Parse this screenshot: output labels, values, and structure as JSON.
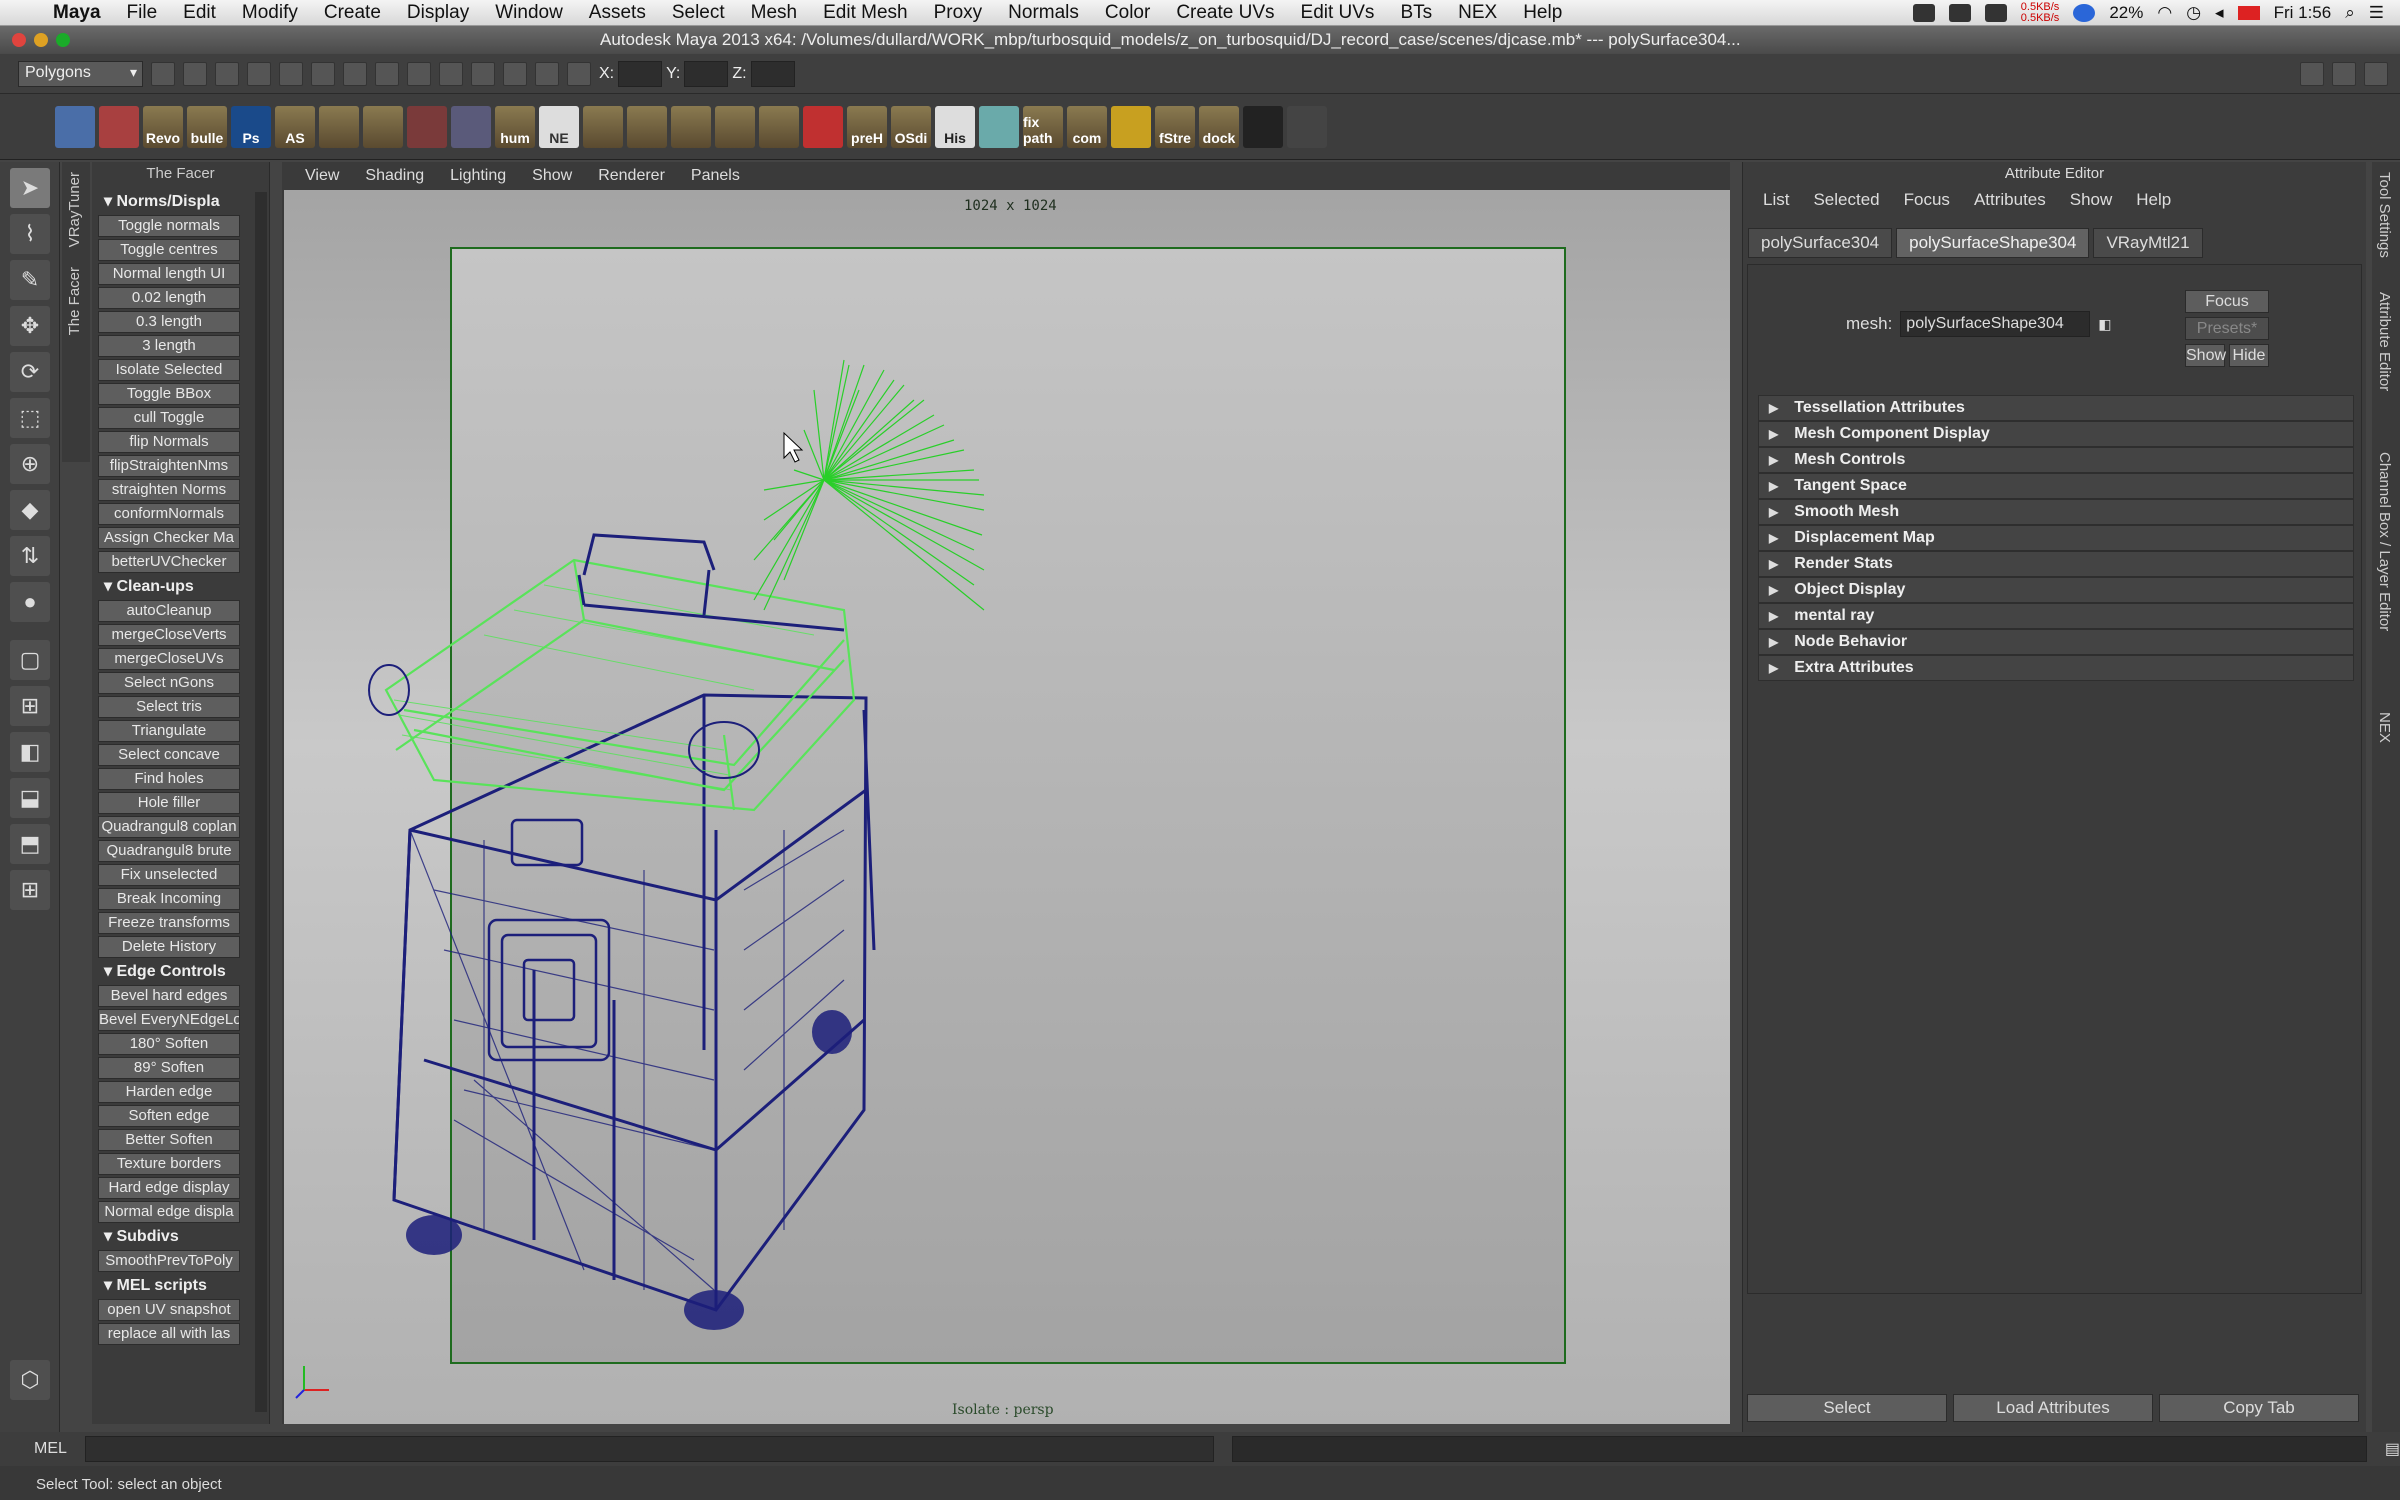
{
  "os_menubar": {
    "app_name": "Maya",
    "items": [
      "File",
      "Edit",
      "Modify",
      "Create",
      "Display",
      "Window",
      "Assets",
      "Select",
      "Mesh",
      "Edit Mesh",
      "Proxy",
      "Normals",
      "Color",
      "Create UVs",
      "Edit UVs",
      "BTs",
      "NEX",
      "Help"
    ],
    "battery": "22%",
    "clock": "Fri 1:56",
    "network_up": "0.5KB/s",
    "network_down": "0.5KB/s"
  },
  "window": {
    "title": "Autodesk Maya 2013 x64: /Volumes/dullard/WORK_mbp/turbosquid_models/z_on_turbosquid/DJ_record_case/scenes/djcase.mb*   ---   polySurface304..."
  },
  "status_line": {
    "mode": "Polygons",
    "x_label": "X:",
    "y_label": "Y:",
    "z_label": "Z:"
  },
  "shelf": {
    "icons": [
      "Revo",
      "bulle",
      "Ps",
      "AS",
      "hum",
      "NE",
      "preH",
      "OSdi",
      "His",
      "fix path",
      "com",
      "fStre",
      "dock"
    ]
  },
  "facer": {
    "title": "The Facer",
    "side_tabs": [
      "VRayTuner",
      "The Facer"
    ],
    "sections": [
      {
        "title": "Norms/Displa",
        "buttons": [
          "Toggle normals",
          "Toggle centres",
          "Normal length UI",
          "0.02 length",
          "0.3 length",
          "3 length",
          "Isolate Selected",
          "Toggle BBox",
          "cull Toggle",
          "flip Normals",
          "flipStraightenNms",
          "straighten Norms",
          "conformNormals",
          "Assign Checker Ma",
          "betterUVChecker"
        ]
      },
      {
        "title": "Clean-ups",
        "buttons": [
          "autoCleanup",
          "mergeCloseVerts",
          "mergeCloseUVs",
          "Select nGons",
          "Select tris",
          "Triangulate",
          "Select concave",
          "Find holes",
          "Hole filler",
          "Quadrangul8 coplan",
          "Quadrangul8 brute",
          "Fix unselected",
          "Break Incoming",
          "Freeze transforms",
          "Delete History"
        ]
      },
      {
        "title": "Edge Controls",
        "buttons": [
          "Bevel hard edges",
          "Bevel EveryNEdgeLoo",
          "180° Soften",
          "89° Soften",
          "Harden edge",
          "Soften edge",
          "Better Soften",
          "Texture borders",
          "Hard edge display",
          "Normal edge displa"
        ]
      },
      {
        "title": "Subdivs",
        "buttons": [
          "SmoothPrevToPoly"
        ]
      },
      {
        "title": "MEL scripts",
        "buttons": [
          "open UV snapshot",
          "replace all with las"
        ]
      }
    ]
  },
  "viewport": {
    "menu": [
      "View",
      "Shading",
      "Lighting",
      "Show",
      "Renderer",
      "Panels"
    ],
    "resolution_label": "1024 x 1024",
    "camera_label": "Isolate : persp"
  },
  "attribute_editor": {
    "title": "Attribute Editor",
    "menu": [
      "List",
      "Selected",
      "Focus",
      "Attributes",
      "Show",
      "Help"
    ],
    "tabs": [
      "polySurface304",
      "polySurfaceShape304",
      "VRayMtl21"
    ],
    "active_tab": "polySurfaceShape304",
    "mesh_label": "mesh:",
    "mesh_value": "polySurfaceShape304",
    "focus_label": "Focus",
    "presets_label": "Presets*",
    "show_label": "Show",
    "hide_label": "Hide",
    "sections": [
      "Tessellation Attributes",
      "Mesh Component Display",
      "Mesh Controls",
      "Tangent Space",
      "Smooth Mesh",
      "Displacement Map",
      "Render Stats",
      "Object Display",
      "mental ray",
      "Node Behavior",
      "Extra Attributes"
    ],
    "bottom_buttons": [
      "Select",
      "Load Attributes",
      "Copy Tab"
    ]
  },
  "right_tabs": [
    "Tool Settings",
    "Attribute Editor",
    "Channel Box / Layer Editor",
    "NEX"
  ],
  "command_line": {
    "label": "MEL"
  },
  "help_line": {
    "text": "Select Tool: select an object"
  },
  "colors": {
    "wireframe": "#1c1f7a",
    "selection": "#59e35a",
    "normals": "#19d119",
    "resolution_gate": "#1e6b1e"
  }
}
